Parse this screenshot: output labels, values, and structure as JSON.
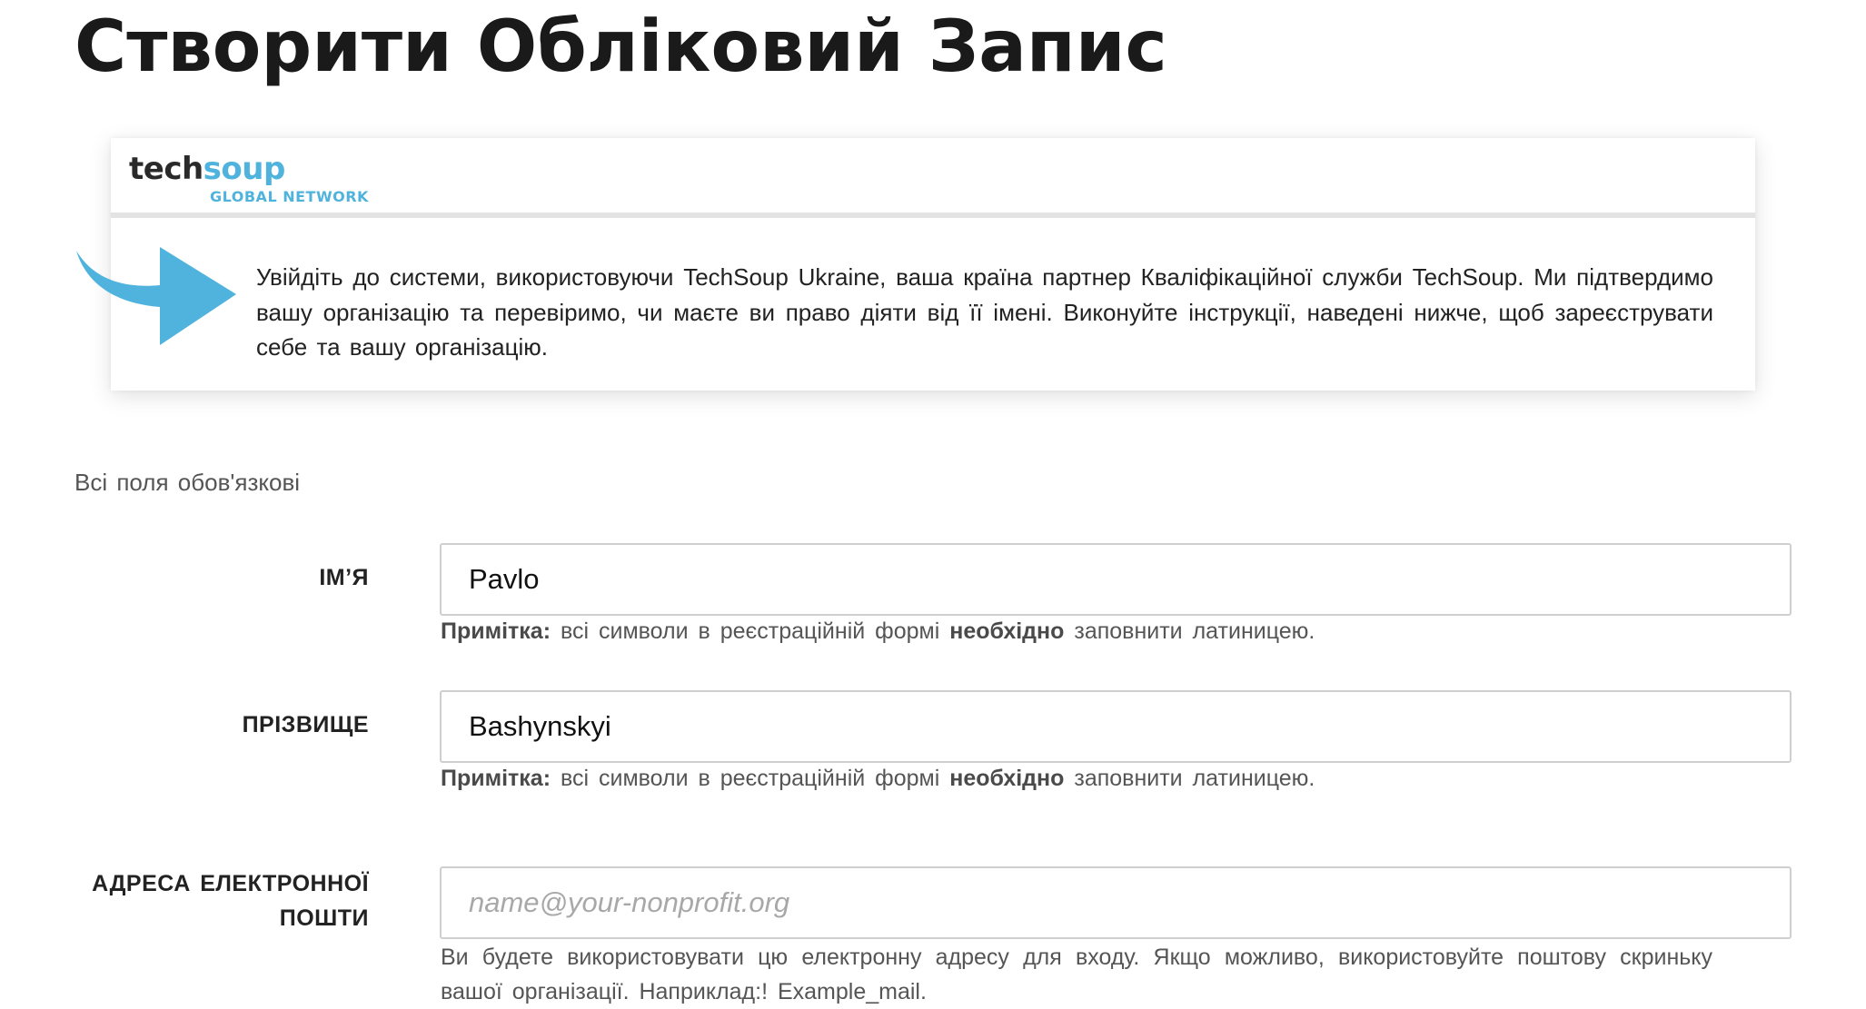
{
  "page": {
    "title": "Створити Обліковий Запис"
  },
  "partner_box": {
    "logo": {
      "word_part1": "tech",
      "word_part2": "soup",
      "subtitle": "GLOBAL NETWORK"
    },
    "intro_text": "Увійдіть до системи, використовуючи TechSoup Ukraine, ваша країна партнер Кваліфікаційної служби TechSoup. Ми підтвердимо вашу організацію та перевіримо, чи маєте ви право діяти від її імені. Виконуйте інструкції, наведені нижче, щоб зареєструвати себе та вашу організацію.",
    "arrow_icon": "arrow-right-icon",
    "accent_color": "#4fb3dd"
  },
  "form": {
    "required_note": "Всі поля обов'язкові",
    "fields": [
      {
        "label": "ІМ’Я",
        "value": "Pavlo",
        "placeholder": "",
        "hint_bold": "Примітка:",
        "hint_text": " всі символи в реєстраційній формі ",
        "hint_bold2": "необхідно",
        "hint_text2": " заповнити латиницею."
      },
      {
        "label": "ПРІЗВИЩЕ",
        "value": "Bashynskyi",
        "placeholder": "",
        "hint_bold": "Примітка:",
        "hint_text": " всі символи в реєстраційній формі ",
        "hint_bold2": "необхідно",
        "hint_text2": " заповнити латиницею."
      },
      {
        "label_line1": "АДРЕСА ЕЛЕКТРОННОЇ",
        "label_line2": "ПОШТИ",
        "value": "",
        "placeholder": "name@your-nonprofit.org",
        "hint_text": "Ви будете використовувати цю електронну адресу для входу. Якщо можливо, використовуйте поштову скриньку вашої організації. Наприклад:! Example_mail."
      }
    ]
  }
}
